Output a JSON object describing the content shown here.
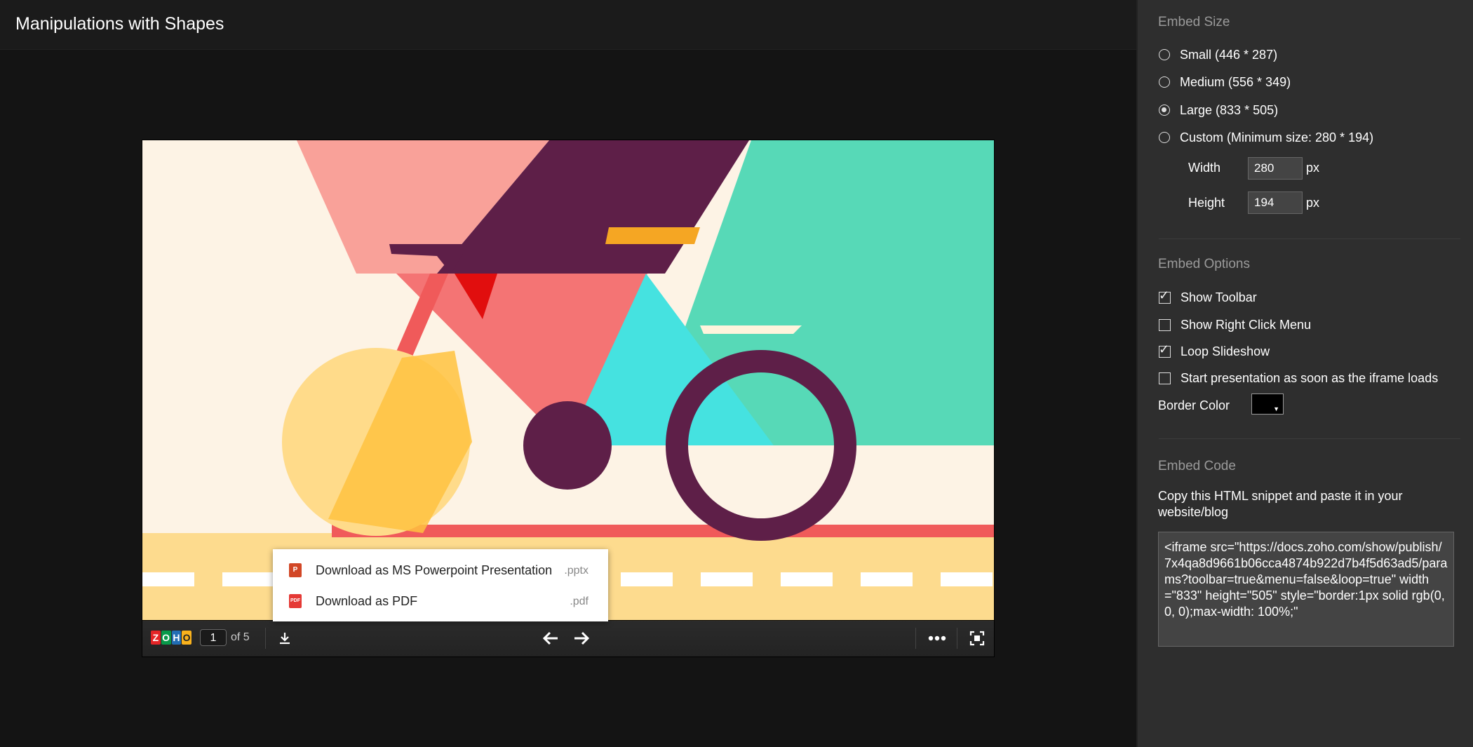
{
  "header": {
    "title": "Manipulations with Shapes"
  },
  "viewer": {
    "logo_letters": [
      "Z",
      "O",
      "H",
      "O"
    ],
    "current_page": "1",
    "page_of": "of 5",
    "download_menu": [
      {
        "label": "Download as MS Powerpoint Presentation",
        "ext": ".pptx",
        "icon": "P",
        "color": "#d24726"
      },
      {
        "label": "Download as PDF",
        "ext": ".pdf",
        "icon": "PDF",
        "color": "#e53935"
      }
    ]
  },
  "panel": {
    "embed_size": {
      "title": "Embed Size",
      "options": [
        {
          "label": "Small (446 * 287)",
          "selected": false
        },
        {
          "label": "Medium (556 * 349)",
          "selected": false
        },
        {
          "label": "Large (833 * 505)",
          "selected": true
        },
        {
          "label": "Custom (Minimum size: 280 * 194)",
          "selected": false
        }
      ],
      "width_label": "Width",
      "width_value": "280",
      "height_label": "Height",
      "height_value": "194",
      "unit": "px"
    },
    "embed_options": {
      "title": "Embed Options",
      "options": [
        {
          "label": "Show Toolbar",
          "checked": true
        },
        {
          "label": "Show Right Click Menu",
          "checked": false
        },
        {
          "label": "Loop Slideshow",
          "checked": true
        },
        {
          "label": "Start presentation as soon as the iframe loads",
          "checked": false
        }
      ],
      "border_color_label": "Border Color",
      "border_color": "#000000"
    },
    "embed_code": {
      "title": "Embed Code",
      "instructions": "Copy this HTML snippet and paste it in your website/blog",
      "code": "<iframe src=\"https://docs.zoho.com/show/publish/7x4qa8d9661b06cca4874b922d7b4f5d63ad5/params?toolbar=true&menu=false&loop=true\" width=\"833\" height=\"505\" style=\"border:1px solid rgb(0, 0, 0);max-width: 100%;\""
    }
  }
}
